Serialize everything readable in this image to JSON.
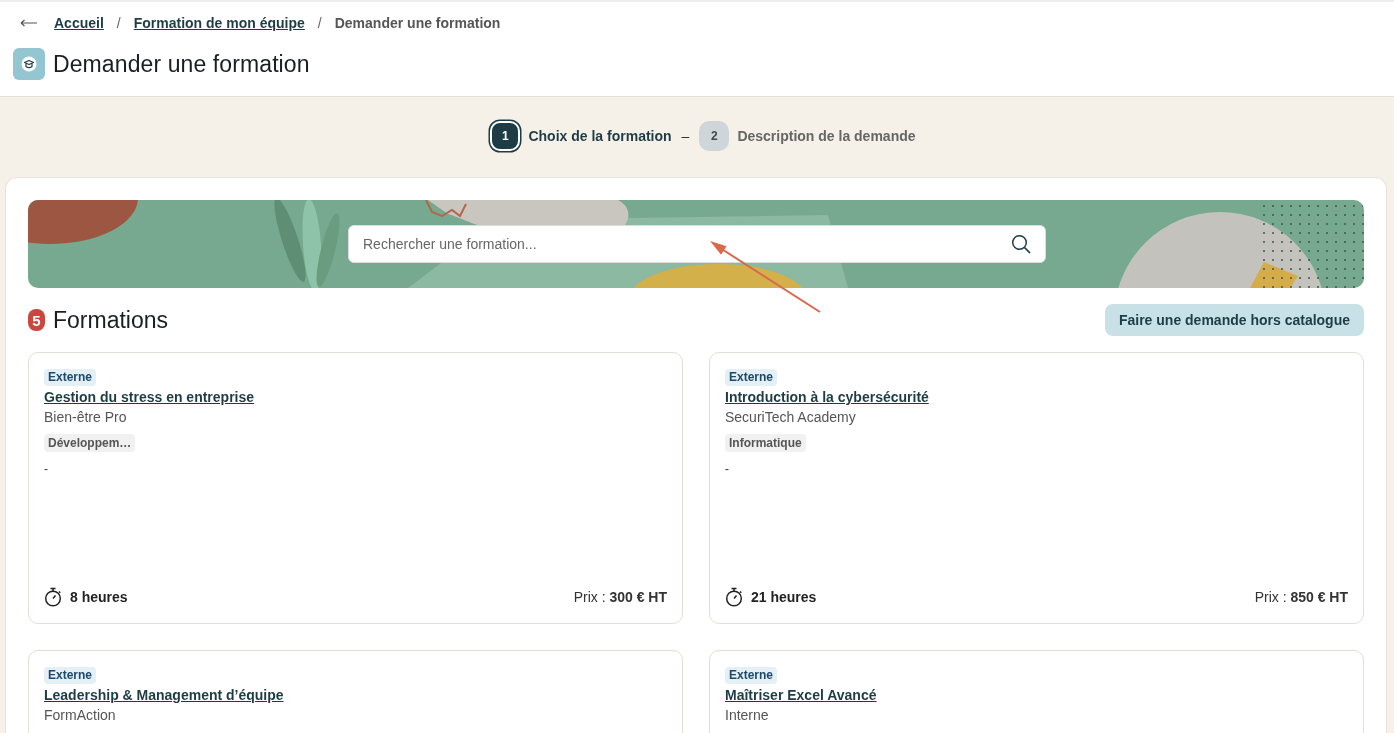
{
  "breadcrumb": {
    "separator": "/",
    "items": [
      {
        "label": "Accueil",
        "kind": "link"
      },
      {
        "label": "Formation de mon équipe",
        "kind": "link"
      },
      {
        "label": "Demander une formation",
        "kind": "current"
      }
    ]
  },
  "page_title": "Demander une formation",
  "stepper": {
    "separator": "–",
    "steps": [
      {
        "number": "1",
        "label": "Choix de la formation",
        "selected": true
      },
      {
        "number": "2",
        "label": "Description de la demande",
        "selected": false
      }
    ]
  },
  "search": {
    "placeholder": "Rechercher une formation..."
  },
  "formations": {
    "count": "5",
    "title": "Formations",
    "action_button": "Faire une demande hors catalogue",
    "cards": [
      {
        "type_badge": "Externe",
        "title": "Gestion du stress en entreprise",
        "provider": "Bien-être Pro",
        "category": "Développem…",
        "description": "-",
        "duration": "8 heures",
        "price": "Prix : **300 € HT**"
      },
      {
        "type_badge": "Externe",
        "title": "Introduction à la cybersécurité",
        "provider": "SecuriTech Academy",
        "category": "Informatique",
        "description": "-",
        "duration": "21 heures",
        "price": "Prix : **850 € HT**"
      },
      {
        "type_badge": "Externe",
        "title": "Leadership & Management d’équipe",
        "provider": "FormAction"
      },
      {
        "type_badge": "Externe",
        "title": "Maîtriser Excel Avancé",
        "provider": "Interne"
      }
    ]
  }
}
